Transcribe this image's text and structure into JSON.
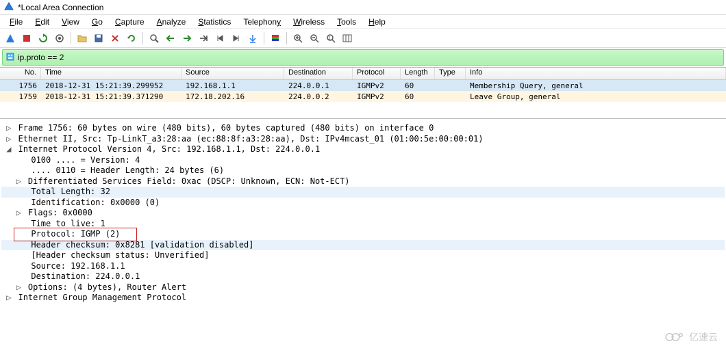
{
  "title": "*Local Area Connection",
  "menu": [
    "File",
    "Edit",
    "View",
    "Go",
    "Capture",
    "Analyze",
    "Statistics",
    "Telephony",
    "Wireless",
    "Tools",
    "Help"
  ],
  "filter": {
    "value": "ip.proto == 2"
  },
  "columns": [
    "No.",
    "Time",
    "Source",
    "Destination",
    "Protocol",
    "Length",
    "Type",
    "Info"
  ],
  "packets": [
    {
      "no": "1756",
      "time": "2018-12-31 15:21:39.299952",
      "src": "192.168.1.1",
      "dst": "224.0.0.1",
      "prot": "IGMPv2",
      "len": "60",
      "type": "",
      "info": "Membership Query, general",
      "sel": true
    },
    {
      "no": "1759",
      "time": "2018-12-31 15:21:39.371290",
      "src": "172.18.202.16",
      "dst": "224.0.0.2",
      "prot": "IGMPv2",
      "len": "60",
      "type": "",
      "info": "Leave Group, general",
      "sel": false
    }
  ],
  "details": {
    "frame": "Frame 1756: 60 bytes on wire (480 bits), 60 bytes captured (480 bits) on interface 0",
    "eth": "Ethernet II, Src: Tp-LinkT_a3:28:aa (ec:88:8f:a3:28:aa), Dst: IPv4mcast_01 (01:00:5e:00:00:01)",
    "ip": "Internet Protocol Version 4, Src: 192.168.1.1, Dst: 224.0.0.1",
    "ip_version": "0100 .... = Version: 4",
    "ip_hlen": ".... 0110 = Header Length: 24 bytes (6)",
    "ip_dsfield": "Differentiated Services Field: 0xac (DSCP: Unknown, ECN: Not-ECT)",
    "ip_totlen": "Total Length: 32",
    "ip_id": "Identification: 0x0000 (0)",
    "ip_flags": "Flags: 0x0000",
    "ip_ttl": "Time to live: 1",
    "ip_proto": "Protocol: IGMP (2)",
    "ip_cksum": "Header checksum: 0x8281 [validation disabled]",
    "ip_cksum_st": "[Header checksum status: Unverified]",
    "ip_src": "Source: 192.168.1.1",
    "ip_dst": "Destination: 224.0.0.1",
    "ip_opts": "Options: (4 bytes), Router Alert",
    "igmp": "Internet Group Management Protocol"
  },
  "watermark": "亿速云"
}
